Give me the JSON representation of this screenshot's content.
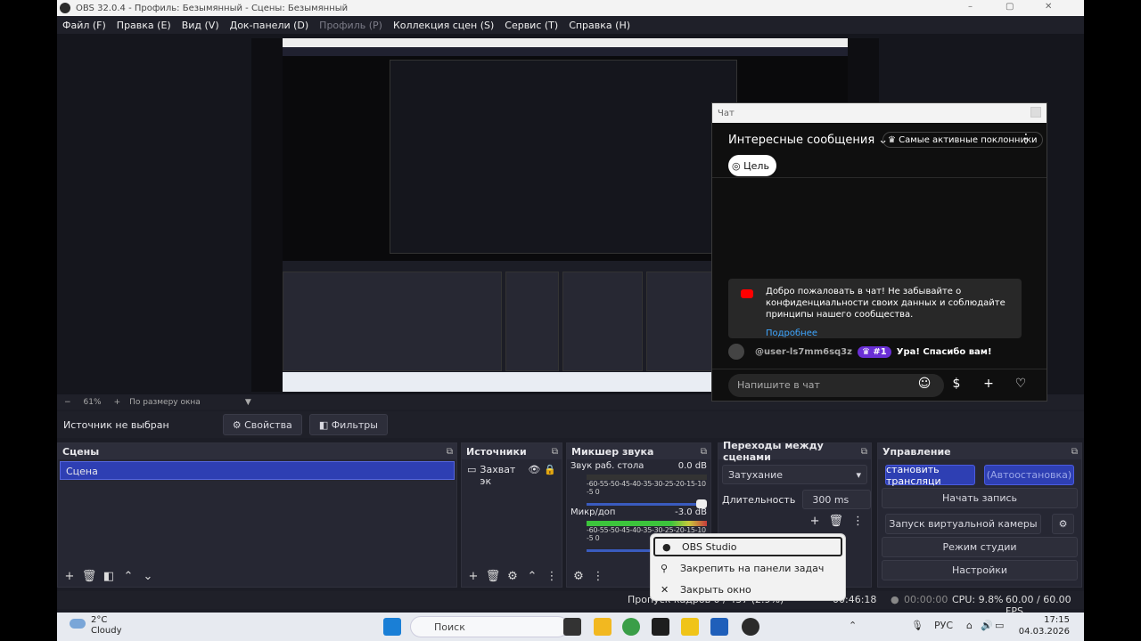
{
  "window": {
    "title": "OBS 32.0.4 - Профиль: Безымянный - Сцены: Безымянный",
    "controls": [
      "–",
      "▢",
      "✕"
    ]
  },
  "menu": [
    {
      "label": "Файл (F)"
    },
    {
      "label": "Правка (E)"
    },
    {
      "label": "Вид (V)"
    },
    {
      "label": "Док-панели (D)"
    },
    {
      "label": "Профиль (P)"
    },
    {
      "label": "Коллекция сцен (S)"
    },
    {
      "label": "Сервис (T)"
    },
    {
      "label": "Справка (H)"
    }
  ],
  "zoom": {
    "minus": "−",
    "value": "61%",
    "plus": "+",
    "mode": "По размеру окна"
  },
  "sourcebar": {
    "label": "Источник не выбран",
    "props": "Свойства",
    "filters": "Фильтры"
  },
  "scenes": {
    "title": "Сцены",
    "items": [
      "Сцена"
    ]
  },
  "sources": {
    "title": "Источники",
    "items": [
      "Захват эк"
    ]
  },
  "mixer": {
    "title": "Микшер звука",
    "channels": [
      {
        "name": "Звук раб. стола",
        "db": "0.0 dB"
      },
      {
        "name": "Микр/доп",
        "db": "-3.0 dB"
      }
    ],
    "ticks": "-60-55-50-45-40-35-30-25-20-15-10 -5  0"
  },
  "transitions": {
    "title": "Переходы между сценами",
    "type": "Затухание",
    "duration_label": "Длительность",
    "duration": "300 ms"
  },
  "controls": {
    "title": "Управление",
    "stream": "становить трансляци",
    "auto": "(Автоостановка)",
    "record": "Начать запись",
    "vcam": "Запуск виртуальной камеры",
    "studio": "Режим студии",
    "settings": "Настройки"
  },
  "status": {
    "dropped": "Пропуск кадров 0 / 437 (2.9%)",
    "timer1": "00:46:18",
    "timer2": "00:00:00",
    "cpu": "CPU: 9.8%",
    "fps": "60.00 / 60.00 FPS"
  },
  "chat": {
    "window_title": "Чат",
    "header": "Интересные сообщения",
    "top_fans": "Самые активные поклонники",
    "goal": "Цель",
    "welcome": "Добро пожаловать в чат! Не забывайте о конфиденциальности своих данных и соблюдайте принципы нашего сообщества.",
    "more": "Подробнее",
    "msg_user": "@user-ls7mm6sq3z",
    "msg_badge": "#1",
    "msg_text": "Ура! Спасибо вам!",
    "input": "Напишите в чат"
  },
  "context_menu": {
    "items": [
      "OBS Studio",
      "Закрепить на панели задач",
      "Закрыть окно"
    ]
  },
  "taskbar": {
    "temp": "2°C",
    "weather": "Cloudy",
    "search": "Поиск",
    "lang": "РУС",
    "time": "17:15",
    "date": "04.03.2026"
  },
  "colors": {
    "accent": "#2e3fb3",
    "panel": "#262733",
    "bg": "#1c1d26",
    "chat_badge": "#6a2fd6"
  }
}
